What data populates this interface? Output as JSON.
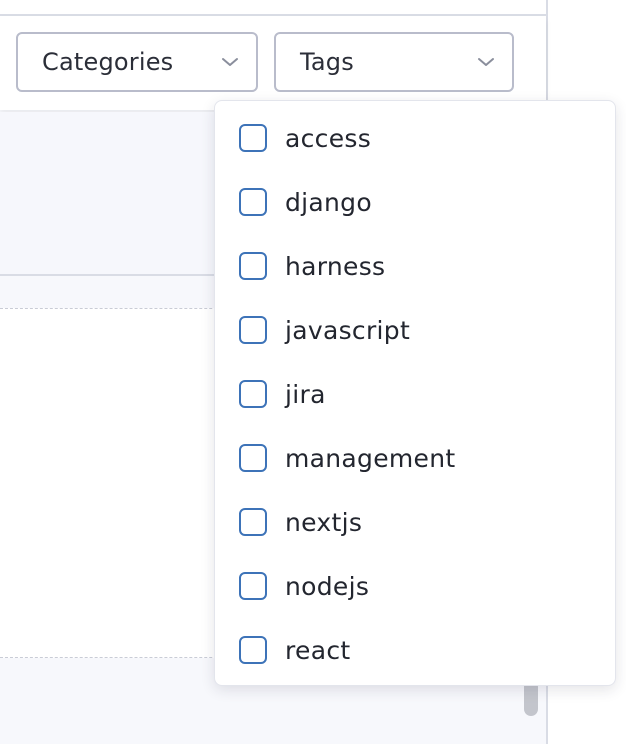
{
  "filters": {
    "categories": {
      "label": "Categories",
      "icon": "chevron-down-icon"
    },
    "tags": {
      "label": "Tags",
      "icon": "chevron-down-icon",
      "expanded": true
    }
  },
  "tags_menu": {
    "options": [
      {
        "label": "access",
        "checked": false
      },
      {
        "label": "django",
        "checked": false
      },
      {
        "label": "harness",
        "checked": false
      },
      {
        "label": "javascript",
        "checked": false
      },
      {
        "label": "jira",
        "checked": false
      },
      {
        "label": "management",
        "checked": false
      },
      {
        "label": "nextjs",
        "checked": false
      },
      {
        "label": "nodejs",
        "checked": false
      },
      {
        "label": "react",
        "checked": false
      }
    ]
  },
  "colors": {
    "checkbox_border": "#3d73b8",
    "select_border": "#b9bccb",
    "panel_background": "#f7f8fc"
  }
}
